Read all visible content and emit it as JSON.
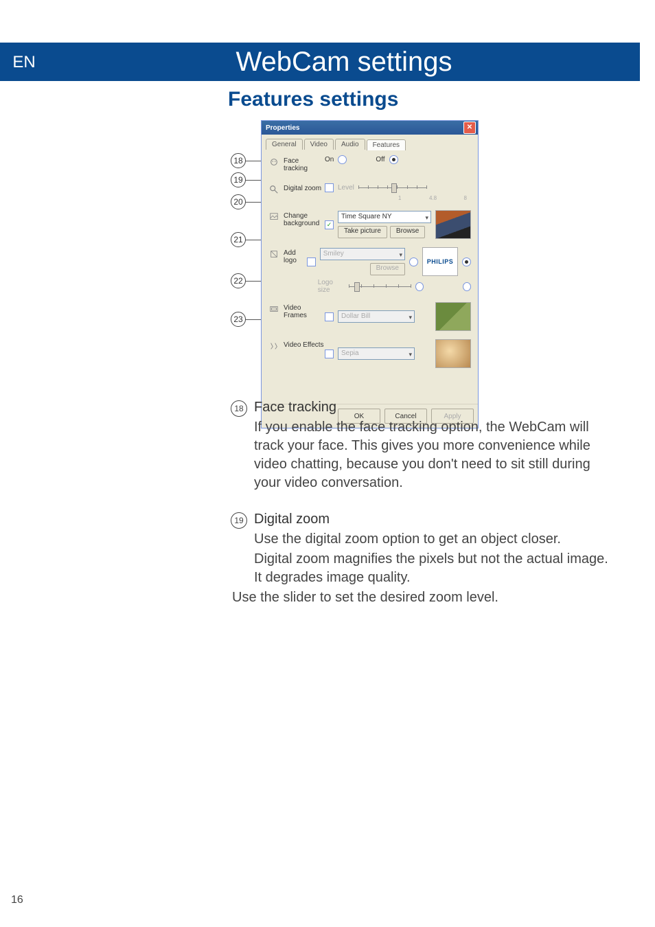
{
  "lang_badge": "EN",
  "title": "WebCam settings",
  "section_title": "Features settings",
  "page_number": "16",
  "callouts": {
    "c18": "18",
    "c19": "19",
    "c20": "20",
    "c21": "21",
    "c22": "22",
    "c23": "23"
  },
  "dialog": {
    "title": "Properties",
    "tabs": [
      "General",
      "Video",
      "Audio",
      "Features"
    ],
    "face_tracking": {
      "label": "Face tracking",
      "on": "On",
      "off": "Off"
    },
    "digital_zoom": {
      "label": "Digital zoom",
      "level_label": "Level",
      "min": "1",
      "val": "4.8",
      "max": "8"
    },
    "change_bg": {
      "label": "Change background",
      "dropdown": "Time Square NY",
      "take_picture": "Take picture",
      "browse": "Browse"
    },
    "add_logo": {
      "label": "Add logo",
      "dropdown": "Smiley",
      "browse": "Browse",
      "size_label": "Logo size",
      "philips": "PHILIPS"
    },
    "video_frames": {
      "label": "Video Frames",
      "dropdown": "Dollar Bill"
    },
    "video_effects": {
      "label": "Video Effects",
      "dropdown": "Sepia"
    },
    "buttons": {
      "ok": "OK",
      "cancel": "Cancel",
      "apply": "Apply"
    }
  },
  "explanations": {
    "face_tracking": {
      "num": "18",
      "heading": "Face tracking",
      "para": "If you enable the face tracking option, the WebCam will track your face. This gives you more convenience while video chatting, because you don't need to sit still during your video conversation."
    },
    "digital_zoom": {
      "num": "19",
      "heading": "Digital zoom",
      "para1": "Use the digital zoom option to get an object closer.",
      "para2": "Digital zoom magnifies the pixels but not the actual image. It degrades image quality.",
      "para3": "Use the slider to set the desired zoom level."
    }
  }
}
